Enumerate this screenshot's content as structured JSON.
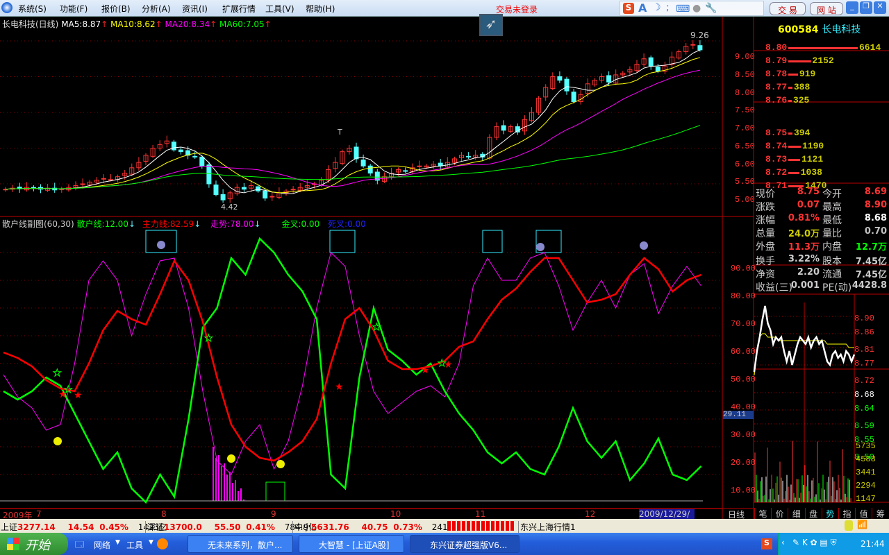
{
  "menu": [
    "系统(S)",
    "功能(F)",
    "报价(B)",
    "分析(A)",
    "资讯(I)",
    "扩展行情",
    "工具(V)",
    "帮助(H)"
  ],
  "login_status": "交易未登录",
  "top_buttons": {
    "trade": "交 易",
    "website": "网 站"
  },
  "main_header": {
    "name": "长电科技(日线)",
    "ma5": "MA5:8.87",
    "ma10": "MA10:8.62",
    "ma20": "MA20:8.34",
    "ma60": "MA60:7.05"
  },
  "indicator_header": {
    "name": "散户线副图(60,30)",
    "retail": "散户线:12.00",
    "main_force": "主力线:82.59",
    "trend": "走势:78.00",
    "golden": "金叉:0.00",
    "death": "死叉:0.00"
  },
  "colors": {
    "up": "#ff3333",
    "down": "#54ffff",
    "ma5": "#ffffff",
    "ma10": "#ffff00",
    "ma20": "#ff00ff",
    "ma60": "#00ff00",
    "retail": "#00ff00",
    "main_force": "#ff0000",
    "trend": "#ff00ff"
  },
  "chart_data": [
    {
      "type": "candlestick",
      "title": "长电科技(日线)",
      "ylim": [
        4.3,
        9.5
      ],
      "yticks": [
        "9.00",
        "8.50",
        "8.00",
        "7.50",
        "7.00",
        "6.50",
        "6.00",
        "5.50",
        "5.00"
      ],
      "closes": [
        4.85,
        4.88,
        4.86,
        4.9,
        4.87,
        4.85,
        4.88,
        4.83,
        4.86,
        4.9,
        4.95,
        5.0,
        5.05,
        5.1,
        5.15,
        5.12,
        5.2,
        5.3,
        5.45,
        5.6,
        5.8,
        6.0,
        6.1,
        6.2,
        5.95,
        5.9,
        5.8,
        5.75,
        5.5,
        5.0,
        4.7,
        4.55,
        4.75,
        4.9,
        4.85,
        4.95,
        4.8,
        4.6,
        4.65,
        4.75,
        4.8,
        4.85,
        4.9,
        4.95,
        5.0,
        5.1,
        5.4,
        5.6,
        5.9,
        6.0,
        5.7,
        5.5,
        5.3,
        5.1,
        5.2,
        5.3,
        5.4,
        5.35,
        5.45,
        5.5,
        5.5,
        5.55,
        5.5,
        5.6,
        5.7,
        5.8,
        5.75,
        5.8,
        5.75,
        6.3,
        6.6,
        6.5,
        6.6,
        6.45,
        6.8,
        7.0,
        7.4,
        7.7,
        8.0,
        7.9,
        7.6,
        7.3,
        7.5,
        7.8,
        7.9,
        8.0,
        7.85,
        8.05,
        8.1,
        8.2,
        8.35,
        8.5,
        8.3,
        8.15,
        8.3,
        8.55,
        8.7,
        8.85,
        8.9,
        8.75
      ],
      "annotations": {
        "low": "4.42",
        "high": "9.26",
        "marker": "T"
      }
    },
    {
      "type": "line",
      "title": "散户线副图(60,30)",
      "ylim": [
        0,
        100
      ],
      "yticks": [
        "90.00",
        "80.00",
        "70.00",
        "60.00",
        "50.00",
        "40.00",
        "30.00",
        "20.00",
        "10.00"
      ],
      "cursor_value": "29.11",
      "series": [
        {
          "name": "散户线",
          "values": [
            40,
            37,
            40,
            45,
            42,
            32,
            22,
            12,
            18,
            5,
            0,
            10,
            2,
            30,
            63,
            70,
            88,
            82,
            95,
            90,
            82,
            76,
            66,
            10,
            5,
            45,
            70,
            55,
            51,
            46,
            50,
            40,
            32,
            26,
            18,
            14,
            18,
            12,
            10,
            20,
            34,
            22,
            16,
            22,
            8,
            14,
            23,
            10,
            8,
            13
          ]
        },
        {
          "name": "主力线",
          "values": [
            54,
            52,
            49,
            44,
            41,
            40,
            50,
            62,
            69,
            66,
            64,
            75,
            87,
            80,
            65,
            45,
            28,
            20,
            16,
            15,
            18,
            22,
            30,
            50,
            66,
            70,
            62,
            51,
            48,
            48,
            49,
            51,
            56,
            58,
            66,
            73,
            77,
            83,
            88,
            88,
            80,
            72,
            73,
            75,
            82,
            88,
            84,
            76,
            80,
            82
          ]
        },
        {
          "name": "走势",
          "values": [
            46,
            38,
            34,
            26,
            28,
            50,
            80,
            87,
            80,
            60,
            75,
            87,
            88,
            70,
            40,
            15,
            10,
            22,
            28,
            12,
            22,
            42,
            70,
            90,
            85,
            60,
            40,
            32,
            36,
            40,
            42,
            38,
            50,
            78,
            88,
            80,
            80,
            88,
            90,
            78,
            62,
            72,
            80,
            70,
            82,
            86,
            68,
            78,
            85,
            78
          ]
        }
      ]
    },
    {
      "type": "line",
      "title": "intraday",
      "ylim": [
        8.48,
        8.92
      ],
      "yticks": [
        "8.90",
        "8.86",
        "8.81",
        "8.77",
        "8.72",
        "8.68",
        "8.64",
        "8.59",
        "8.55",
        "8.50"
      ],
      "vol_ticks": [
        "5735",
        "4588",
        "3441",
        "2294",
        "1147"
      ],
      "price": [
        8.7,
        8.76,
        8.8,
        8.85,
        8.89,
        8.84,
        8.82,
        8.78,
        8.8,
        8.79,
        8.8,
        8.76,
        8.73,
        8.76,
        8.72,
        8.75,
        8.78,
        8.8,
        8.79,
        8.78,
        8.8,
        8.77,
        8.79,
        8.8,
        8.78,
        8.79,
        8.76,
        8.73,
        8.72,
        8.75,
        8.76,
        8.74,
        8.75,
        8.73,
        8.76,
        8.75,
        8.73,
        8.75
      ],
      "avg": [
        8.69,
        8.76,
        8.8,
        8.81,
        8.81,
        8.8,
        8.8,
        8.8,
        8.8,
        8.79,
        8.79,
        8.79,
        8.79,
        8.79,
        8.79,
        8.79,
        8.79,
        8.79,
        8.79,
        8.79,
        8.79,
        8.79,
        8.79,
        8.79,
        8.79,
        8.79,
        8.79,
        8.78,
        8.78,
        8.78,
        8.78,
        8.78,
        8.78,
        8.78,
        8.78,
        8.77,
        8.77,
        8.77
      ]
    }
  ],
  "date_axis": {
    "year": "2009年",
    "months": [
      "7",
      "8",
      "9",
      "10",
      "11",
      "12"
    ],
    "cursor_date": "2009/12/29/二",
    "period": "日线"
  },
  "quote": {
    "code": "600584",
    "name": "长电科技",
    "asks": [
      {
        "price": "8.80",
        "vol": 6614
      },
      {
        "price": "8.79",
        "vol": 2152
      },
      {
        "price": "8.78",
        "vol": 919
      },
      {
        "price": "8.77",
        "vol": 388
      },
      {
        "price": "8.76",
        "vol": 325
      }
    ],
    "bids": [
      {
        "price": "8.75",
        "vol": 394
      },
      {
        "price": "8.74",
        "vol": 1190
      },
      {
        "price": "8.73",
        "vol": 1121
      },
      {
        "price": "8.72",
        "vol": 1038
      },
      {
        "price": "8.71",
        "vol": 1470
      }
    ],
    "stats": [
      {
        "l1": "现价",
        "v1": "8.75",
        "c1": "#ff3333",
        "l2": "今开",
        "v2": "8.69",
        "c2": "#ff3333"
      },
      {
        "l1": "涨跌",
        "v1": "0.07",
        "c1": "#ff3333",
        "l2": "最高",
        "v2": "8.90",
        "c2": "#ff3333"
      },
      {
        "l1": "涨幅",
        "v1": "0.81%",
        "c1": "#ff3333",
        "l2": "最低",
        "v2": "8.68",
        "c2": "#ffffff"
      },
      {
        "l1": "总量",
        "v1": "24.0万",
        "c1": "#cccc00",
        "l2": "量比",
        "v2": "0.70",
        "c2": "#c0c0c0"
      },
      {
        "l1": "外盘",
        "v1": "11.3万",
        "c1": "#ff3333",
        "l2": "内盘",
        "v2": "12.7万",
        "c2": "#00ff00"
      }
    ],
    "stats2": [
      {
        "l1": "换手",
        "v1": "3.22%",
        "l2": "股本",
        "v2": "7.45亿"
      },
      {
        "l1": "净资",
        "v1": "2.20",
        "l2": "流通",
        "v2": "7.45亿"
      },
      {
        "l1": "收益(三)",
        "v1": "0.001",
        "l2": "PE(动)",
        "v2": "4428.8"
      }
    ]
  },
  "tabs": [
    "笔",
    "价",
    "细",
    "盘",
    "势",
    "指",
    "值",
    "筹"
  ],
  "status": {
    "sh_name": "上证",
    "sh": "3277.14",
    "sh_chg": "14.54",
    "sh_pct": "0.45%",
    "sh_amt": "1423亿",
    "sz_name": "深证",
    "sz": "13700.0",
    "sz_chg": "55.50",
    "sz_pct": "0.41%",
    "sz_amt": "784.9亿",
    "zx_name": "中小",
    "zx": "5631.76",
    "zx_chg": "40.75",
    "zx_pct": "0.73%",
    "zx_amt": "241.3亿",
    "server": "东兴上海行情1"
  },
  "taskbar": {
    "start": "开始",
    "quick1": "网络",
    "quick2": "工具",
    "tasks": [
      "无未来系列，散户...",
      "大智慧 - [上证A股]",
      "东兴证券超强版V6..."
    ],
    "clock": "21:44"
  }
}
